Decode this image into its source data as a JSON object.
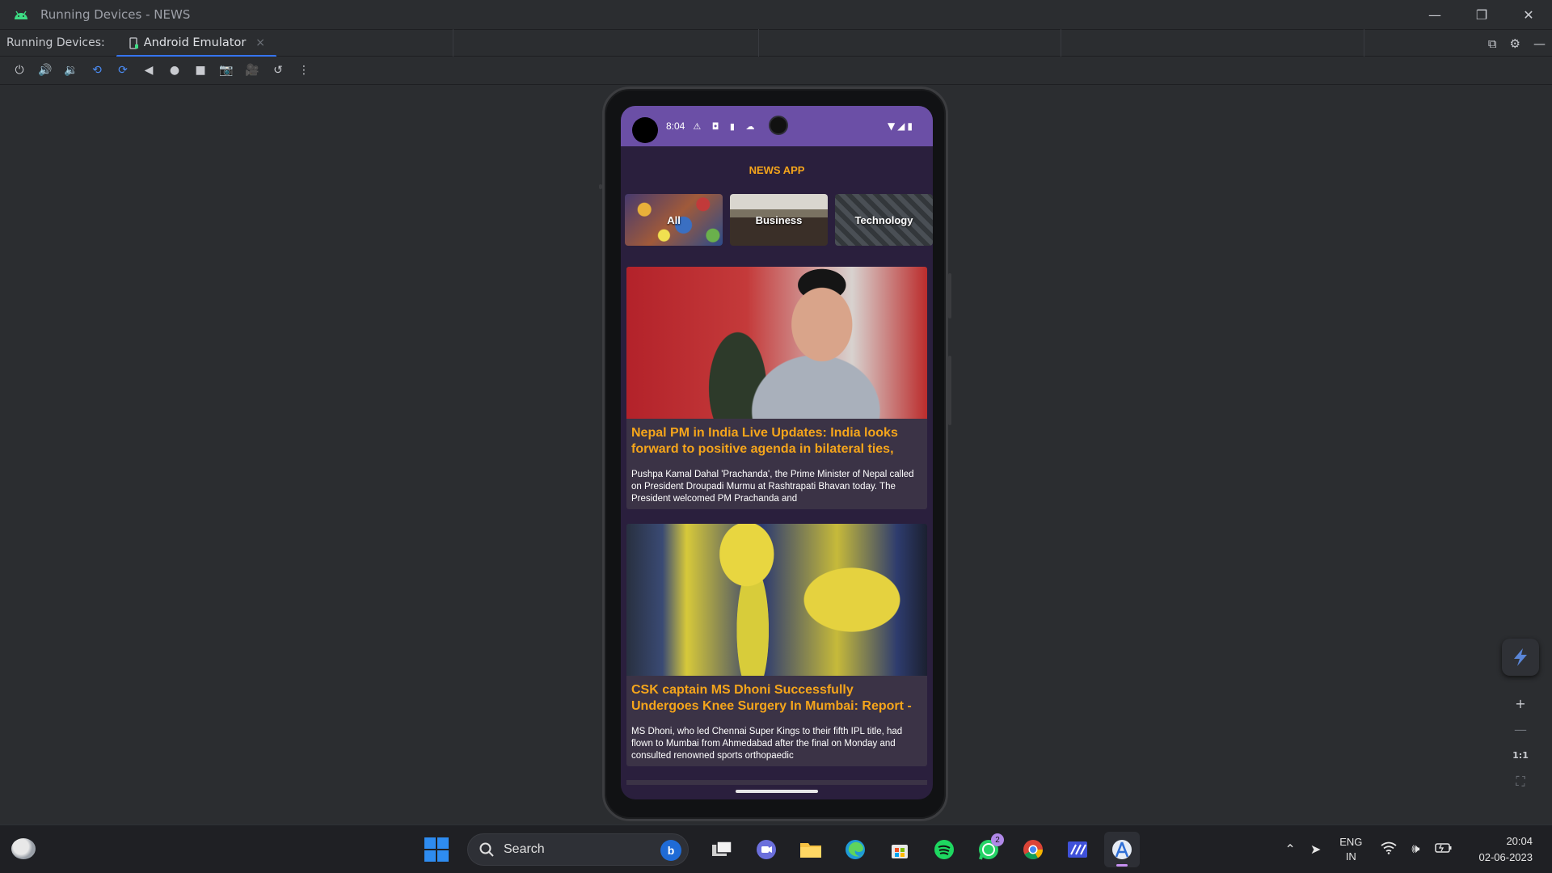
{
  "window": {
    "title": "Running Devices - NEWS",
    "controls": [
      "—",
      "❐",
      "✕"
    ]
  },
  "tabbar": {
    "label": "Running Devices:",
    "tab_label": "Android Emulator",
    "tab_close": "×",
    "right_icons": [
      "⧉",
      "⚙",
      "—"
    ]
  },
  "toolbar": {
    "icons": [
      "power-icon",
      "volume-up-icon",
      "volume-down-icon",
      "rotate-left-icon",
      "rotate-right-icon",
      "back-icon",
      "home-icon",
      "overview-icon",
      "camera-icon",
      "record-icon",
      "reset-icon",
      "more-icon"
    ],
    "glyphs": [
      "⏻",
      "🔊",
      "🔉",
      "⟲",
      "⟳",
      "◀",
      "●",
      "■",
      "📷",
      "🎥",
      "↺",
      "⋮"
    ]
  },
  "phone": {
    "status_time": "8:04",
    "status_left_icons": "⚠ ◘ ▮ ☁",
    "status_right_icons": "▼◢▮",
    "app_title": "NEWS APP",
    "categories": [
      {
        "label": "All"
      },
      {
        "label": "Business"
      },
      {
        "label": "Technology"
      }
    ],
    "articles": [
      {
        "headline": "Nepal PM in India Live Updates: India looks forward to positive agenda in bilateral ties, says",
        "description": "Pushpa Kamal Dahal 'Prachanda', the Prime Minister of Nepal called on President Droupadi Murmu at Rashtrapati Bhavan today. The President welcomed PM Prachanda and"
      },
      {
        "headline": "CSK captain MS Dhoni Successfully Undergoes Knee Surgery In Mumbai: Report - NDTV Sports",
        "description": "MS Dhoni, who led Chennai Super Kings to their fifth IPL title, had flown to Mumbai from Ahmedabad after the final on Monday and consulted renowned sports orthopaedic"
      }
    ]
  },
  "zoom": {
    "plus": "+",
    "minus": "—",
    "actual": "1:1",
    "fit": "⛶"
  },
  "taskbar": {
    "search_placeholder": "Search",
    "bing_label": "b",
    "whatsapp_badge": "2",
    "language_line1": "ENG",
    "language_line2": "IN",
    "time": "20:04",
    "date": "02-06-2023"
  },
  "colors": {
    "accent": "#3574f0",
    "headline": "#f5a51b",
    "statusbar": "#6b4fa6",
    "app_bg": "#2a1f3d"
  }
}
